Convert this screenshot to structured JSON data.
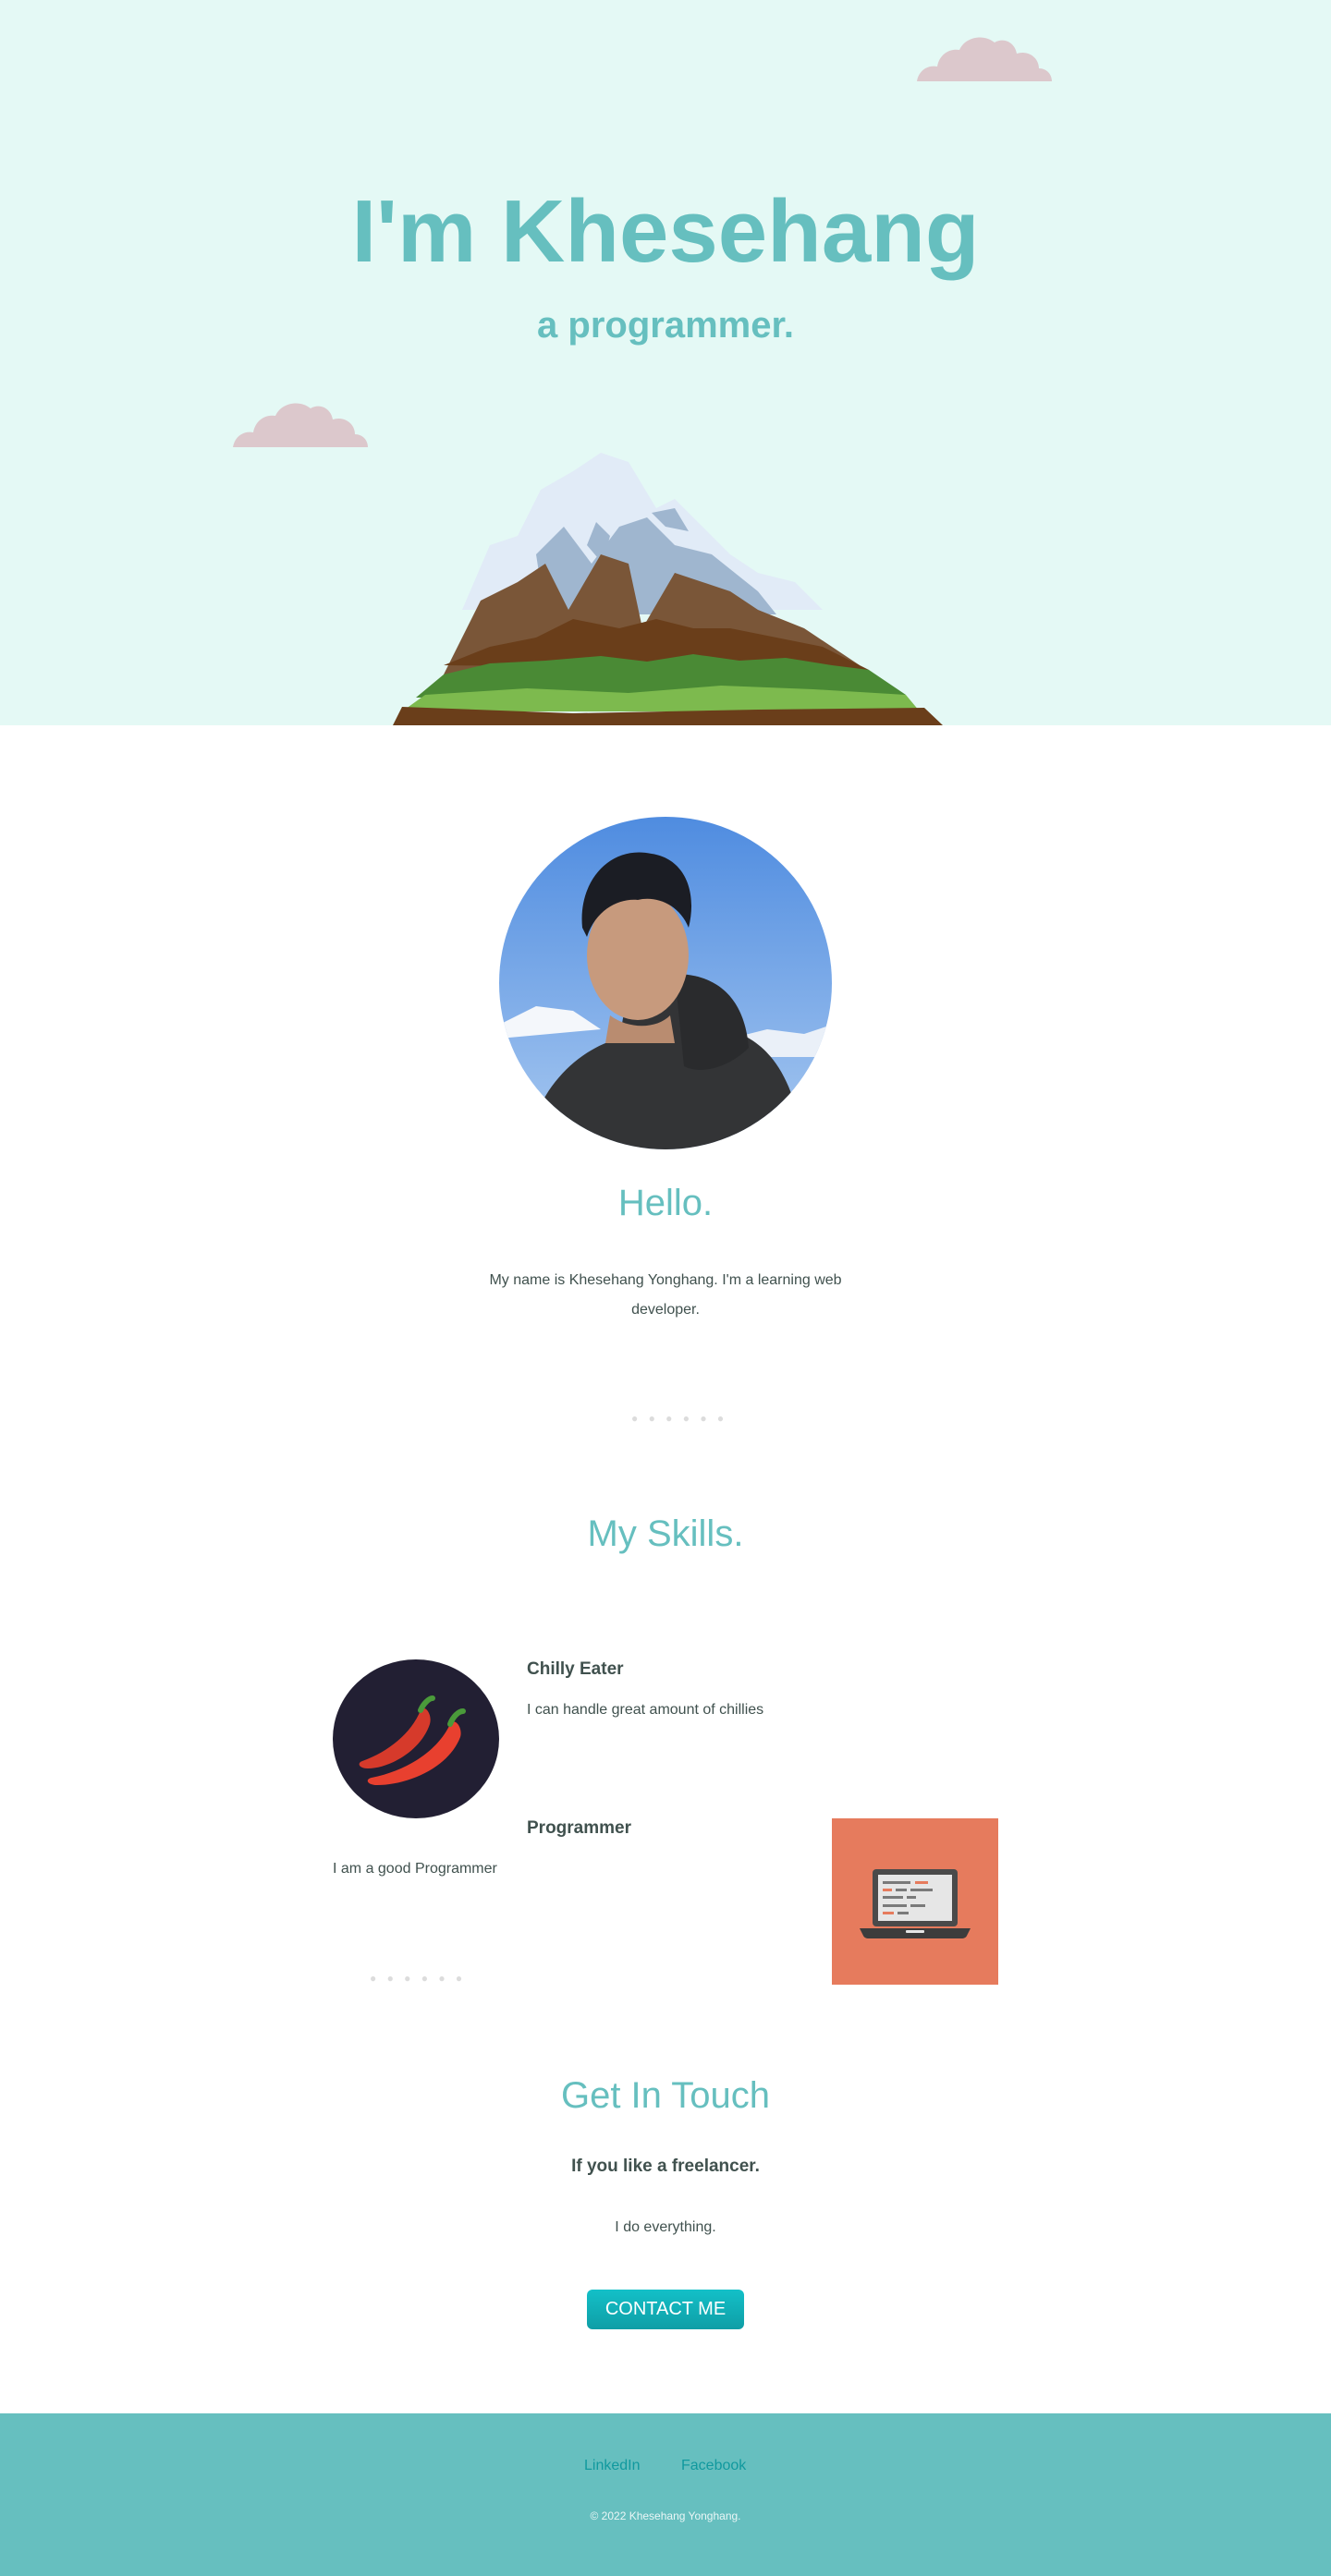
{
  "hero": {
    "title": "I'm Khesehang",
    "subtitle": "a programmer."
  },
  "about": {
    "heading": "Hello.",
    "text": "My name is Khesehang Yonghang. I'm a learning web developer."
  },
  "dividers": {
    "dots": "● ● ● ● ● ●"
  },
  "skills": {
    "heading": "My Skills.",
    "items": [
      {
        "name": "Chilly Eater",
        "description": "I can handle great amount of chillies",
        "icon": "chili-pepper-icon"
      },
      {
        "name": "Programmer",
        "description": "I am a good Programmer",
        "icon": "laptop-icon"
      }
    ]
  },
  "contact": {
    "heading": "Get In Touch",
    "subheading": "If you like a freelancer.",
    "text": "I do everything.",
    "button_label": "CONTACT ME"
  },
  "footer": {
    "links": [
      {
        "label": "LinkedIn"
      },
      {
        "label": "Facebook"
      }
    ],
    "copyright": "© 2022 Khesehang Yonghang."
  },
  "colors": {
    "hero_bg": "#e4f9f5",
    "accent": "#66bfbf",
    "text": "#40514e",
    "button": "#11999e",
    "skill_card_bg": "#e67b5d"
  }
}
